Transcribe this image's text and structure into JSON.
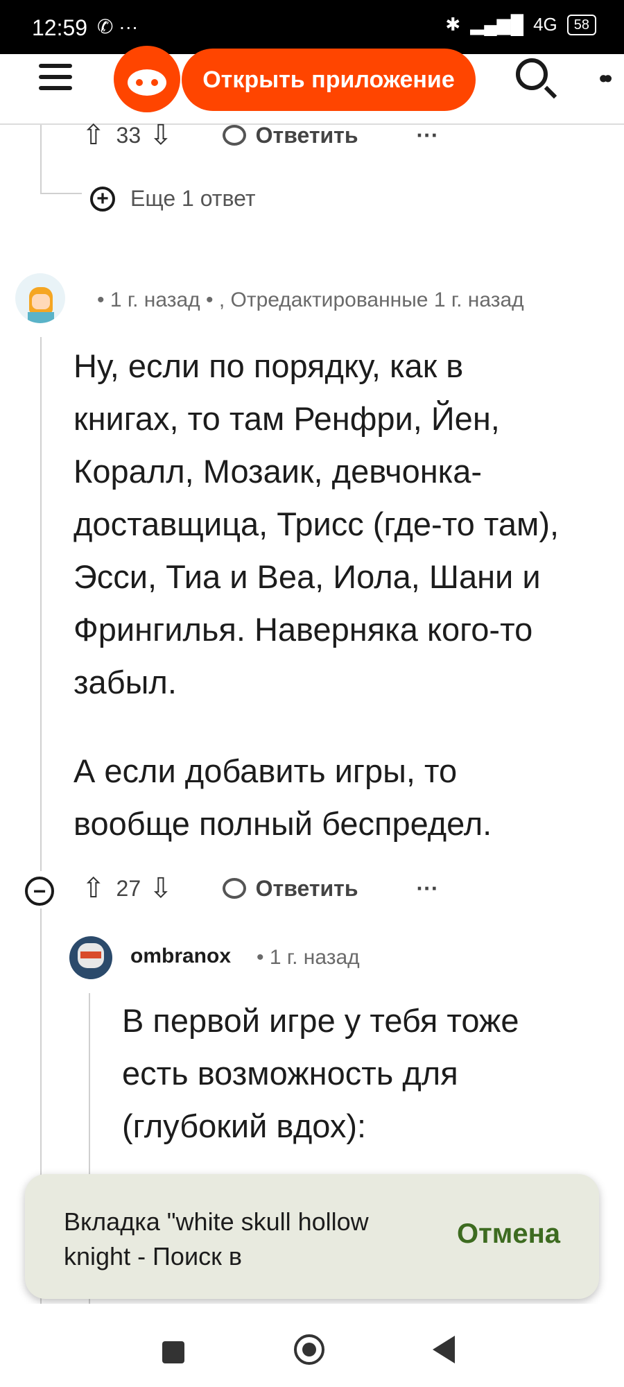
{
  "status_bar": {
    "time": "12:59",
    "icons_left": "✆ ···",
    "signal": "4G",
    "battery": "58"
  },
  "header": {
    "open_app_label": "Открыть приложение"
  },
  "top_comment": {
    "upvotes": "33",
    "reply_label": "Ответить",
    "more_label": "···",
    "more_replies": "Еще 1 ответ"
  },
  "comment": {
    "meta": "• 1 г. назад • , Отредактированные 1 г. назад",
    "paragraphs": [
      "Ну, если по порядку, как в книгах, то там Ренфри, Йен, Коралл, Мозаик, девчонка-доставщица, Трисс (где-то там), Эсси, Тиа и Веа, Иола, Шани и Фрингилья. Наверняка кого-то забыл.",
      "А если добавить игры, то вообще полный беспредел."
    ],
    "upvotes": "27",
    "reply_label": "Ответить",
    "more_label": "···"
  },
  "reply": {
    "username": "ombranox",
    "time": "• 1 г. назад",
    "text": "В первой игре у тебя тоже есть возможность для (глубокий вдох):"
  },
  "toast": {
    "message": "Вкладка \"white skull hollow knight - Поиск в",
    "undo_label": "Отмена"
  },
  "colors": {
    "accent": "#ff4500",
    "undo": "#3d6b20",
    "toast_bg": "#e8eadf"
  }
}
